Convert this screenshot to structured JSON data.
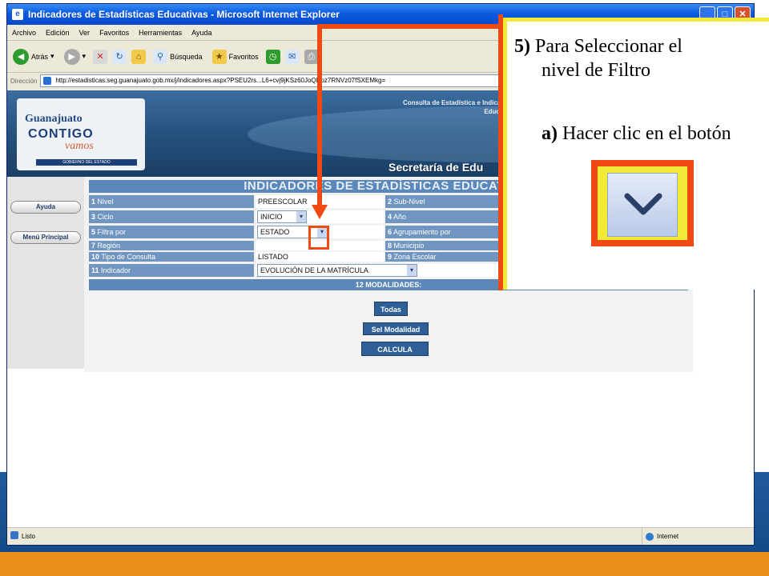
{
  "window": {
    "title": "Indicadores de Estadísticas Educativas - Microsoft Internet Explorer",
    "app_icon": "ie-page-icon",
    "buttons": [
      "minimize",
      "maximize",
      "close"
    ]
  },
  "menubar": [
    "Archivo",
    "Edición",
    "Ver",
    "Favoritos",
    "Herramientas",
    "Ayuda"
  ],
  "toolbar": {
    "back_label": "Atrás",
    "search_label": "Búsqueda",
    "favorites_label": "Favoritos"
  },
  "address": {
    "label": "Dirección",
    "url": "http://estadisticas.seg.guanajuato.gob.mx/j/indicadores.aspx?PSEU2rs...L6+cvj9jKSz60JoQNpz7RNVz07fSXEMkg="
  },
  "banner": {
    "logo_line1": "Guanajuato",
    "logo_line2": "CONTIGO",
    "logo_line3": "vamos",
    "logo_line4": "GOBIERNO DEL ESTADO",
    "top_right": "Consulta de Estadística e Indicadores Educativos",
    "secretaria": "Secretaría de Edu"
  },
  "sidebar": {
    "ayuda": "Ayuda",
    "menu": "Menú Principal"
  },
  "form": {
    "header": "INDICADORES DE ESTADÍSTICAS EDUCATIVAS",
    "rows": [
      {
        "l_num": "1",
        "l_label": "Nivel",
        "l_value": "PREESCOLAR",
        "r_num": "2",
        "r_label": "Sub-Nivel"
      },
      {
        "l_num": "3",
        "l_label": "Ciclo",
        "l_value": "INICIO",
        "r_num": "4",
        "r_label": "Año"
      },
      {
        "l_num": "5",
        "l_label": "Filtra por",
        "l_value": "ESTADO",
        "r_num": "6",
        "r_label": "Agrupamiento por"
      },
      {
        "l_num": "7",
        "l_label": "Región",
        "l_value": "",
        "r_num": "8",
        "r_label": "Municipio"
      },
      {
        "l_num": "10",
        "l_label": "Tipo de Consulta",
        "l_value": "LISTADO",
        "r_num": "9",
        "r_label": "Zona Escolar"
      },
      {
        "l_num": "11",
        "l_label": "Indicador",
        "l_value": "EVOLUCIÓN DE LA MATRÍCULA"
      }
    ],
    "modalidades": "12 MODALIDADES:",
    "btn_todas": "Todas",
    "btn_sel": "Sel Modalidad",
    "btn_calcula": "CALCULA"
  },
  "status": {
    "left": "Listo",
    "right": "Internet"
  },
  "callout": {
    "step_num": "5)",
    "title_rest": "Para Seleccionar el",
    "title_line2": "nivel de Filtro",
    "sub_letter": "a)",
    "sub_text": "Hacer clic en el botón",
    "accent_red": "#f04a14",
    "accent_yellow": "#f2ea36"
  }
}
